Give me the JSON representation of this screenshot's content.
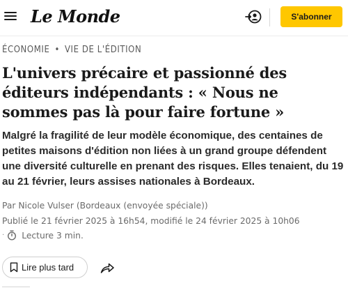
{
  "header": {
    "logo_text": "Le Monde",
    "subscribe_label": "S'abonner",
    "accent_color": "#ffc700",
    "icons": [
      "menu-icon",
      "account-icon"
    ]
  },
  "article": {
    "rubric": [
      "ÉCONOMIE",
      "VIE DE L'ÉDITION"
    ],
    "title": "L'univers précaire et passionné des éditeurs indépendants : « Nous ne sommes pas là pour faire fortune »",
    "lede": "Malgré la fragilité de leur modèle économique, des centaines de petites maisons d'édition non liées à un grand groupe défendent une diversité culturelle en prenant des risques. Elles tenaient, du 19 au 21 février, leurs assises nationales à Bordeaux.",
    "author": "Par Nicole Vulser (Bordeaux (envoyée spéciale))",
    "dates": "Publié le 21 février 2025 à 16h54, modifié le 24 février 2025 à 10h06",
    "reading_time": "Lecture 3 min."
  },
  "actions": {
    "save_label": "Lire plus tard",
    "icons": [
      "bookmark-icon",
      "share-icon",
      "timer-icon"
    ]
  }
}
